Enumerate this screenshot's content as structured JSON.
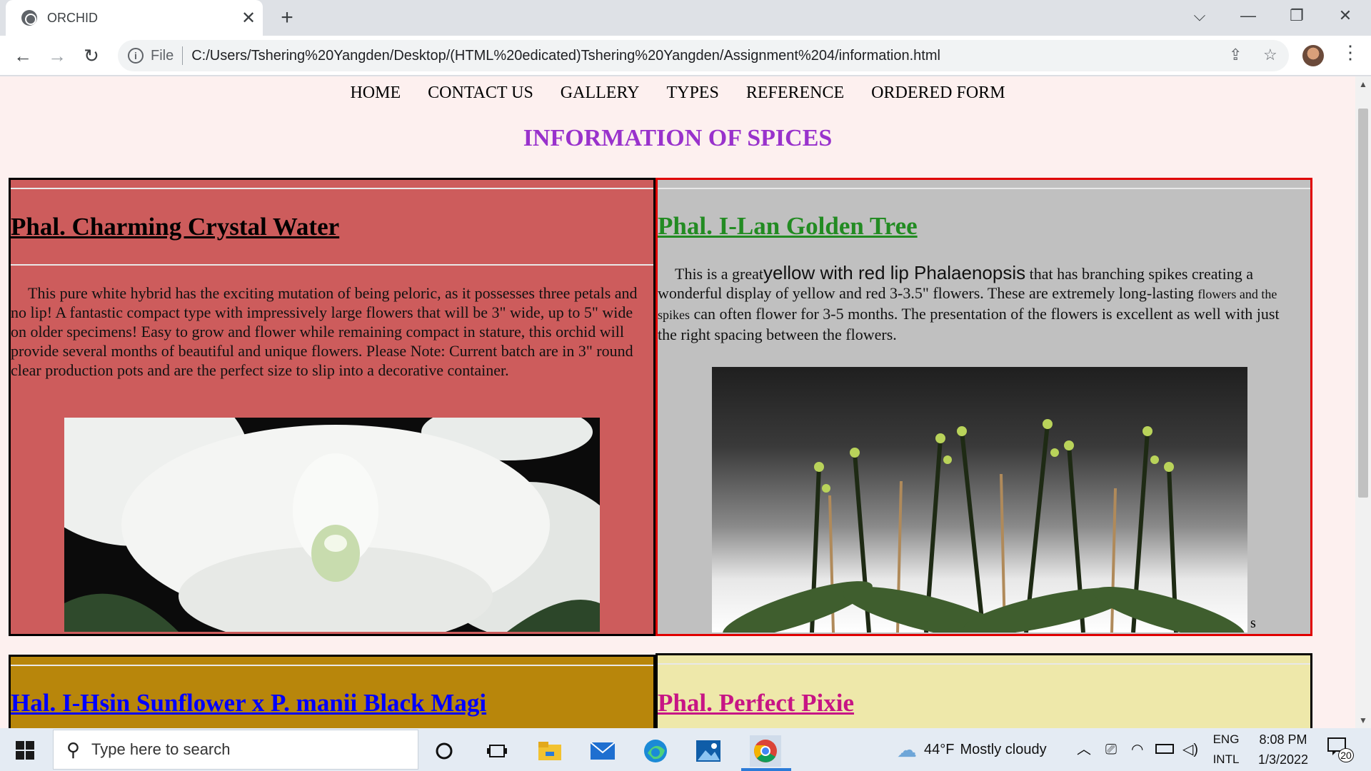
{
  "browser": {
    "tab_title": "ORCHID",
    "close_glyph": "✕",
    "new_tab_glyph": "+",
    "controls": {
      "dropdown": "⌵",
      "minimize": "—",
      "restore": "❐",
      "close": "✕"
    },
    "nav": {
      "back": "←",
      "forward": "→",
      "reload": "↻"
    },
    "info_glyph": "i",
    "scheme_label": "File",
    "url": "C:/Users/Tshering%20Yangden/Desktop/(HTML%20edicated)Tshering%20Yangden/Assignment%204/information.html",
    "share_glyph": "⇪",
    "bookmark_glyph": "☆",
    "menu_glyph": "⋮"
  },
  "page": {
    "nav": [
      "HOME",
      "CONTACT US",
      "GALLERY",
      "TYPES",
      "REFERENCE",
      "ORDERED FORM"
    ],
    "title": "INFORMATION OF SPICES",
    "cards": [
      {
        "heading": "Phal. Charming Crystal Water",
        "heading_color": "#000000",
        "background": "#cd5c5c",
        "description": "This pure white hybrid has the exciting mutation of being peloric, as it possesses three petals and no lip! A fantastic compact type with impressively large flowers that will be 3\" wide, up to 5\" wide on older specimens! Easy to grow and flower while remaining compact in stature, this orchid will provide several months of beautiful and unique flowers. Please Note: Current batch are in 3\" round clear production pots and are the perfect size to slip into a decorative container."
      },
      {
        "heading": "Phal. I-Lan Golden Tree",
        "heading_color": "#228b22",
        "background": "#c0c0c0",
        "description_parts": [
          "This is a great",
          "yellow with red lip Phalaenopsis",
          " that has branching spikes creating a wonderful display of yellow and red 3-3.5\" flowers. These are extremely long-lasting ",
          "flowers and the spikes",
          " can often flower for 3-5 months. The presentation of the flowers is excellent as well with just the right spacing between the flowers."
        ],
        "trailing_text": "s"
      },
      {
        "heading": "Hal. I-Hsin Sunflower x P. manii Black Magi",
        "heading_color": "#0000ff",
        "background": "#b8860b"
      },
      {
        "heading": "Phal. Perfect Pixie",
        "heading_color": "#c71585",
        "background": "#eee8aa"
      }
    ]
  },
  "taskbar": {
    "search_placeholder": "Type here to search",
    "weather": {
      "temp": "44°F",
      "condition": "Mostly cloudy"
    },
    "language": {
      "primary": "ENG",
      "secondary": "INTL"
    },
    "clock": {
      "time": "8:08 PM",
      "date": "1/3/2022"
    },
    "notifications": "20",
    "scroll_up": "▲",
    "scroll_down": "▼"
  }
}
